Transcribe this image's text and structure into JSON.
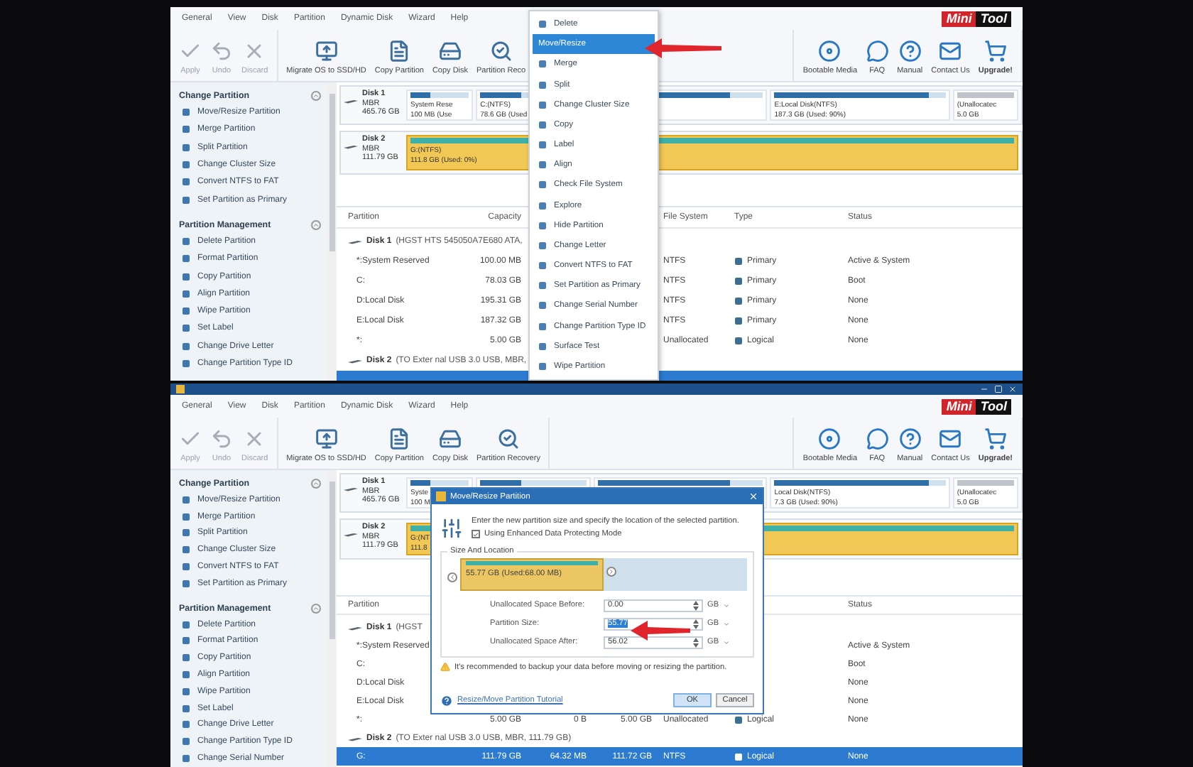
{
  "screens": [
    {
      "kind": "plain",
      "menu": [
        "General",
        "View",
        "Disk",
        "Partition",
        "Dynamic Disk",
        "Wizard",
        "Help"
      ],
      "logo": [
        "Mini",
        "Tool"
      ],
      "toolbar": {
        "edit": [
          {
            "label": "Apply",
            "disabled": true
          },
          {
            "label": "Undo",
            "disabled": true
          },
          {
            "label": "Discard",
            "disabled": true
          }
        ],
        "tools": [
          {
            "label": "Migrate OS to SSD/HD",
            "disabled": false
          },
          {
            "label": "Copy Partition",
            "disabled": false
          },
          {
            "label": "Copy Disk",
            "disabled": false
          },
          {
            "label": "Partition Reco",
            "disabled": false
          }
        ],
        "help": [
          {
            "label": "Bootable Media",
            "disabled": false
          },
          {
            "label": "FAQ",
            "disabled": false
          },
          {
            "label": "Manual",
            "disabled": false
          },
          {
            "label": "Contact Us",
            "disabled": false
          },
          {
            "label": "Upgrade!",
            "disabled": false
          }
        ]
      },
      "sidebar": [
        {
          "title": "Change Partition",
          "expanded": true,
          "items": [
            "Move/Resize Partition",
            "Merge Partition",
            "Split Partition",
            "Change Cluster Size",
            "Convert NTFS to FAT",
            "Set Partition as Primary"
          ]
        },
        {
          "title": "Partition Management",
          "expanded": true,
          "items": [
            "Delete Partition",
            "Format Partition",
            "Copy Partition",
            "Align Partition",
            "Wipe Partition",
            "Set Label",
            "Change Drive Letter",
            "Change Partition Type ID"
          ]
        }
      ],
      "disks": [
        {
          "name": "Disk 1",
          "scheme": "MBR",
          "size": "465.76 GB",
          "partitions": [
            {
              "kind": "primary",
              "label": "System Rese",
              "detail": "100 MB (Use",
              "level": 0.35,
              "selected": false
            },
            {
              "kind": "primary",
              "label": "C:(NTFS)",
              "detail": "78.6 GB (Used",
              "level": 0.39,
              "selected": false
            },
            {
              "kind": "primary",
              "level": 0.8,
              "selected": false
            },
            {
              "kind": "primary",
              "label": "E:Local Disk(NTFS)",
              "detail": "187.3 GB (Used: 90%)",
              "level": 0.9,
              "selected": false
            },
            {
              "kind": "unallocated",
              "label": "(Unallocatec",
              "detail": "5.0 GB",
              "selected": false
            }
          ]
        },
        {
          "name": "Disk 2",
          "scheme": "MBR",
          "size": "111.79 GB",
          "partitions": [
            {
              "kind": "primary",
              "label": "G:(NTFS)",
              "detail": "111.8 GB (Used: 0%)",
              "level": 1,
              "selected": true
            }
          ]
        }
      ],
      "table": {
        "columns": [
          "Partition",
          "Capacity",
          null,
          null,
          "File System",
          "Type",
          "Status"
        ],
        "groups": [
          {
            "disk": "Disk 1",
            "info": "(HGST HTS 545050A7E680 ATA,",
            "rows": [
              {
                "cells": [
                  "*:System Reserved",
                  "100.00 MB",
                  null,
                  null,
                  "NTFS",
                  "Primary",
                  "Active & System"
                ],
                "selected": false
              },
              {
                "cells": [
                  "C:",
                  "78.03 GB",
                  null,
                  null,
                  "NTFS",
                  "Primary",
                  "Boot"
                ],
                "selected": false
              },
              {
                "cells": [
                  "D:Local Disk",
                  "195.31 GB",
                  null,
                  null,
                  "NTFS",
                  "Primary",
                  "None"
                ],
                "selected": false
              },
              {
                "cells": [
                  "E:Local Disk",
                  "187.32 GB",
                  null,
                  null,
                  "NTFS",
                  "Primary",
                  "None"
                ],
                "selected": false
              },
              {
                "cells": [
                  "*:",
                  "5.00 GB",
                  null,
                  null,
                  "Unallocated",
                  "Logical",
                  "None"
                ],
                "selected": false
              }
            ]
          },
          {
            "disk": "Disk 2",
            "info": "(TO Exter nal USB 3.0 USB, MBR,",
            "rows": [
              {
                "cells": [
                  null,
                  null,
                  null,
                  null,
                  null,
                  null,
                  null
                ],
                "selected": true
              }
            ]
          }
        ]
      },
      "overlay": {
        "kind": "context_menu",
        "items": [
          {
            "label": "Delete",
            "selected": false
          },
          {
            "label": "Move/Resize",
            "selected": true
          },
          {
            "label": "Merge",
            "selected": false
          },
          {
            "label": "Split",
            "selected": false
          },
          {
            "label": "Change Cluster Size",
            "selected": false
          },
          {
            "label": "Copy",
            "selected": false
          },
          {
            "label": "Label",
            "selected": false
          },
          {
            "label": "Align",
            "selected": false
          },
          {
            "label": "Check File System",
            "selected": false
          },
          {
            "label": "Explore",
            "selected": false
          },
          {
            "label": "Hide Partition",
            "selected": false
          },
          {
            "label": "Change Letter",
            "selected": false
          },
          {
            "label": "Convert NTFS to FAT",
            "selected": false
          },
          {
            "label": "Set Partition as Primary",
            "selected": false
          },
          {
            "label": "Change Serial Number",
            "selected": false
          },
          {
            "label": "Change Partition Type ID",
            "selected": false
          },
          {
            "label": "Surface Test",
            "selected": false
          },
          {
            "label": "Wipe Partition",
            "selected": false
          }
        ]
      }
    },
    {
      "kind": "titled",
      "menu": [
        "General",
        "View",
        "Disk",
        "Partition",
        "Dynamic Disk",
        "Wizard",
        "Help"
      ],
      "logo": [
        "Mini",
        "Tool"
      ],
      "toolbar": {
        "edit": [
          {
            "label": "Apply",
            "disabled": true
          },
          {
            "label": "Undo",
            "disabled": true
          },
          {
            "label": "Discard",
            "disabled": true
          }
        ],
        "tools": [
          {
            "label": "Migrate OS to SSD/HD",
            "disabled": false
          },
          {
            "label": "Copy Partition",
            "disabled": false
          },
          {
            "label": "Copy Disk",
            "disabled": false
          },
          {
            "label": "Partition Recovery",
            "disabled": false
          }
        ],
        "help": [
          {
            "label": "Bootable Media",
            "disabled": false
          },
          {
            "label": "FAQ",
            "disabled": false
          },
          {
            "label": "Manual",
            "disabled": false
          },
          {
            "label": "Contact Us",
            "disabled": false
          },
          {
            "label": "Upgrade!",
            "disabled": false
          }
        ]
      },
      "sidebar": [
        {
          "title": "Change Partition",
          "expanded": true,
          "items": [
            "Move/Resize Partition",
            "Merge Partition",
            "Split Partition",
            "Change Cluster Size",
            "Convert NTFS to FAT",
            "Set Partition as Primary"
          ]
        },
        {
          "title": "Partition Management",
          "expanded": true,
          "items": [
            "Delete Partition",
            "Format Partition",
            "Copy Partition",
            "Align Partition",
            "Wipe Partition",
            "Set Label",
            "Change Drive Letter",
            "Change Partition Type ID",
            "Change Serial Number"
          ]
        }
      ],
      "disks": [
        {
          "name": "Disk 1",
          "scheme": "MBR",
          "size": "465.76 GB",
          "partitions": [
            {
              "kind": "primary",
              "label": "Syste",
              "detail": "100 M",
              "level": 0.35,
              "selected": false
            },
            {
              "kind": "primary",
              "level": 0.39,
              "selected": false
            },
            {
              "kind": "primary",
              "level": 0.8,
              "selected": false
            },
            {
              "kind": "primary",
              "label": "Local Disk(NTFS)",
              "detail": "7.3 GB (Used: 90%)",
              "level": 0.9,
              "selected": false
            },
            {
              "kind": "unallocated",
              "label": "(Unallocatec",
              "detail": "5.0 GB",
              "selected": false
            }
          ]
        },
        {
          "name": "Disk 2",
          "scheme": "MBR",
          "size": "111.79 GB",
          "partitions": [
            {
              "kind": "primary",
              "label": "G:(NT",
              "detail": "111.8",
              "level": 1,
              "selected": true
            }
          ]
        }
      ],
      "table": {
        "columns": [
          "Partition",
          null,
          null,
          null,
          null,
          null,
          "Status"
        ],
        "groups": [
          {
            "disk": "Disk 1",
            "info": "(HGST",
            "rows": [
              {
                "cells": [
                  "*:System Reserved",
                  null,
                  null,
                  null,
                  null,
                  null,
                  "Active & System"
                ],
                "selected": false
              },
              {
                "cells": [
                  "C:",
                  null,
                  null,
                  null,
                  null,
                  null,
                  "Boot"
                ],
                "selected": false
              },
              {
                "cells": [
                  "D:Local Disk",
                  null,
                  null,
                  null,
                  null,
                  null,
                  "None"
                ],
                "selected": false
              },
              {
                "cells": [
                  "E:Local Disk",
                  null,
                  null,
                  null,
                  null,
                  null,
                  "None"
                ],
                "selected": false
              },
              {
                "cells": [
                  "*:",
                  "5.00 GB",
                  "0 B",
                  "5.00 GB",
                  "Unallocated",
                  "Logical",
                  "None"
                ],
                "selected": false
              }
            ]
          },
          {
            "disk": "Disk 2",
            "info": "(TO Exter nal USB 3.0 USB, MBR, 111.79 GB)",
            "rows": [
              {
                "cells": [
                  "G:",
                  "111.79 GB",
                  "64.32 MB",
                  "111.72 GB",
                  "NTFS",
                  "Logical",
                  "None"
                ],
                "selected": true
              }
            ]
          }
        ]
      },
      "overlay": {
        "kind": "dialog",
        "title": "Move/Resize Partition",
        "intro": "Enter the new partition size and specify the location of the selected partition.",
        "option": {
          "label": "Using Enhanced Data Protecting Mode",
          "checked": true
        },
        "group": "Size And Location",
        "bar": {
          "label": "55.77 GB (Used:68.00 MB)",
          "level": 0.5
        },
        "fields": [
          {
            "label": "Unallocated Space Before:",
            "value": "0.00",
            "unit": "GB",
            "highlighted": false
          },
          {
            "label": "Partition Size:",
            "value": "55.77",
            "unit": "GB",
            "highlighted": true
          },
          {
            "label": "Unallocated Space After:",
            "value": "56.02",
            "unit": "GB",
            "highlighted": false
          }
        ],
        "warning": "It's recommended to backup your data before moving or resizing the partition.",
        "link": "Resize/Move Partition Tutorial",
        "buttons": [
          "OK",
          "Cancel"
        ]
      }
    }
  ]
}
